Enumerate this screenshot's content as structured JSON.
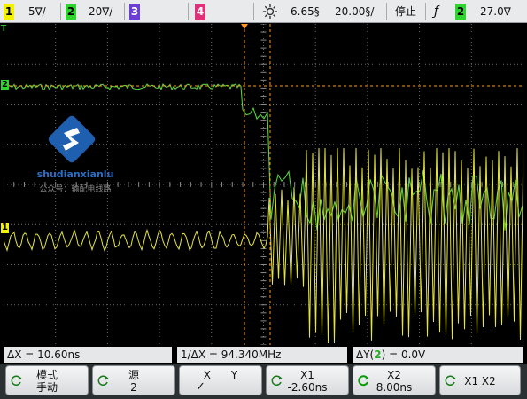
{
  "status_bar": {
    "ch1": {
      "number": "1",
      "scale": "5∇/",
      "color": "#f2f200"
    },
    "ch2": {
      "number": "2",
      "scale": "20∇/",
      "color": "#2fd62f"
    },
    "ch3": {
      "number": "3",
      "color": "#6b3fd6"
    },
    "ch4": {
      "number": "4",
      "color": "#e0307a"
    },
    "trigger_position": "6.65§",
    "timebase": "20.00§/",
    "run_state": "停止",
    "trigger_slope_glyph": "ƒ",
    "trigger_source": "2",
    "trigger_level": "27.0∇"
  },
  "markers": {
    "ch2_marker": "2",
    "ch1_marker": "1",
    "trigger_marker": "T"
  },
  "logo": {
    "name": "shudianxianlu",
    "subtitle": "公众号：输配电线路"
  },
  "readouts": {
    "delta_x": "ΔX = 10.60ns",
    "inv_delta_x": "1/ΔX = 94.340MHz",
    "delta_y_prefix": "ΔY(",
    "delta_y_source": "2",
    "delta_y_suffix": ") = 0.0V"
  },
  "softkeys": [
    {
      "line1": "模式",
      "line2": "手动",
      "knob": true
    },
    {
      "line1": "源",
      "line2": "2",
      "knob": true
    },
    {
      "line1": "X      Y",
      "line2": "✓",
      "knob": false
    },
    {
      "line1": "X1",
      "line2": "-2.60ns",
      "knob": true
    },
    {
      "line1": "X2",
      "line2": "8.00ns",
      "knob": true,
      "active": true
    },
    {
      "line1": "X1 X2",
      "line2": "",
      "knob": true
    }
  ],
  "colors": {
    "ch1_trace": "#e6e63a",
    "ch2_trace": "#55d23c",
    "cursor": "#ff9a1f",
    "grid": "#6a6a6a"
  }
}
